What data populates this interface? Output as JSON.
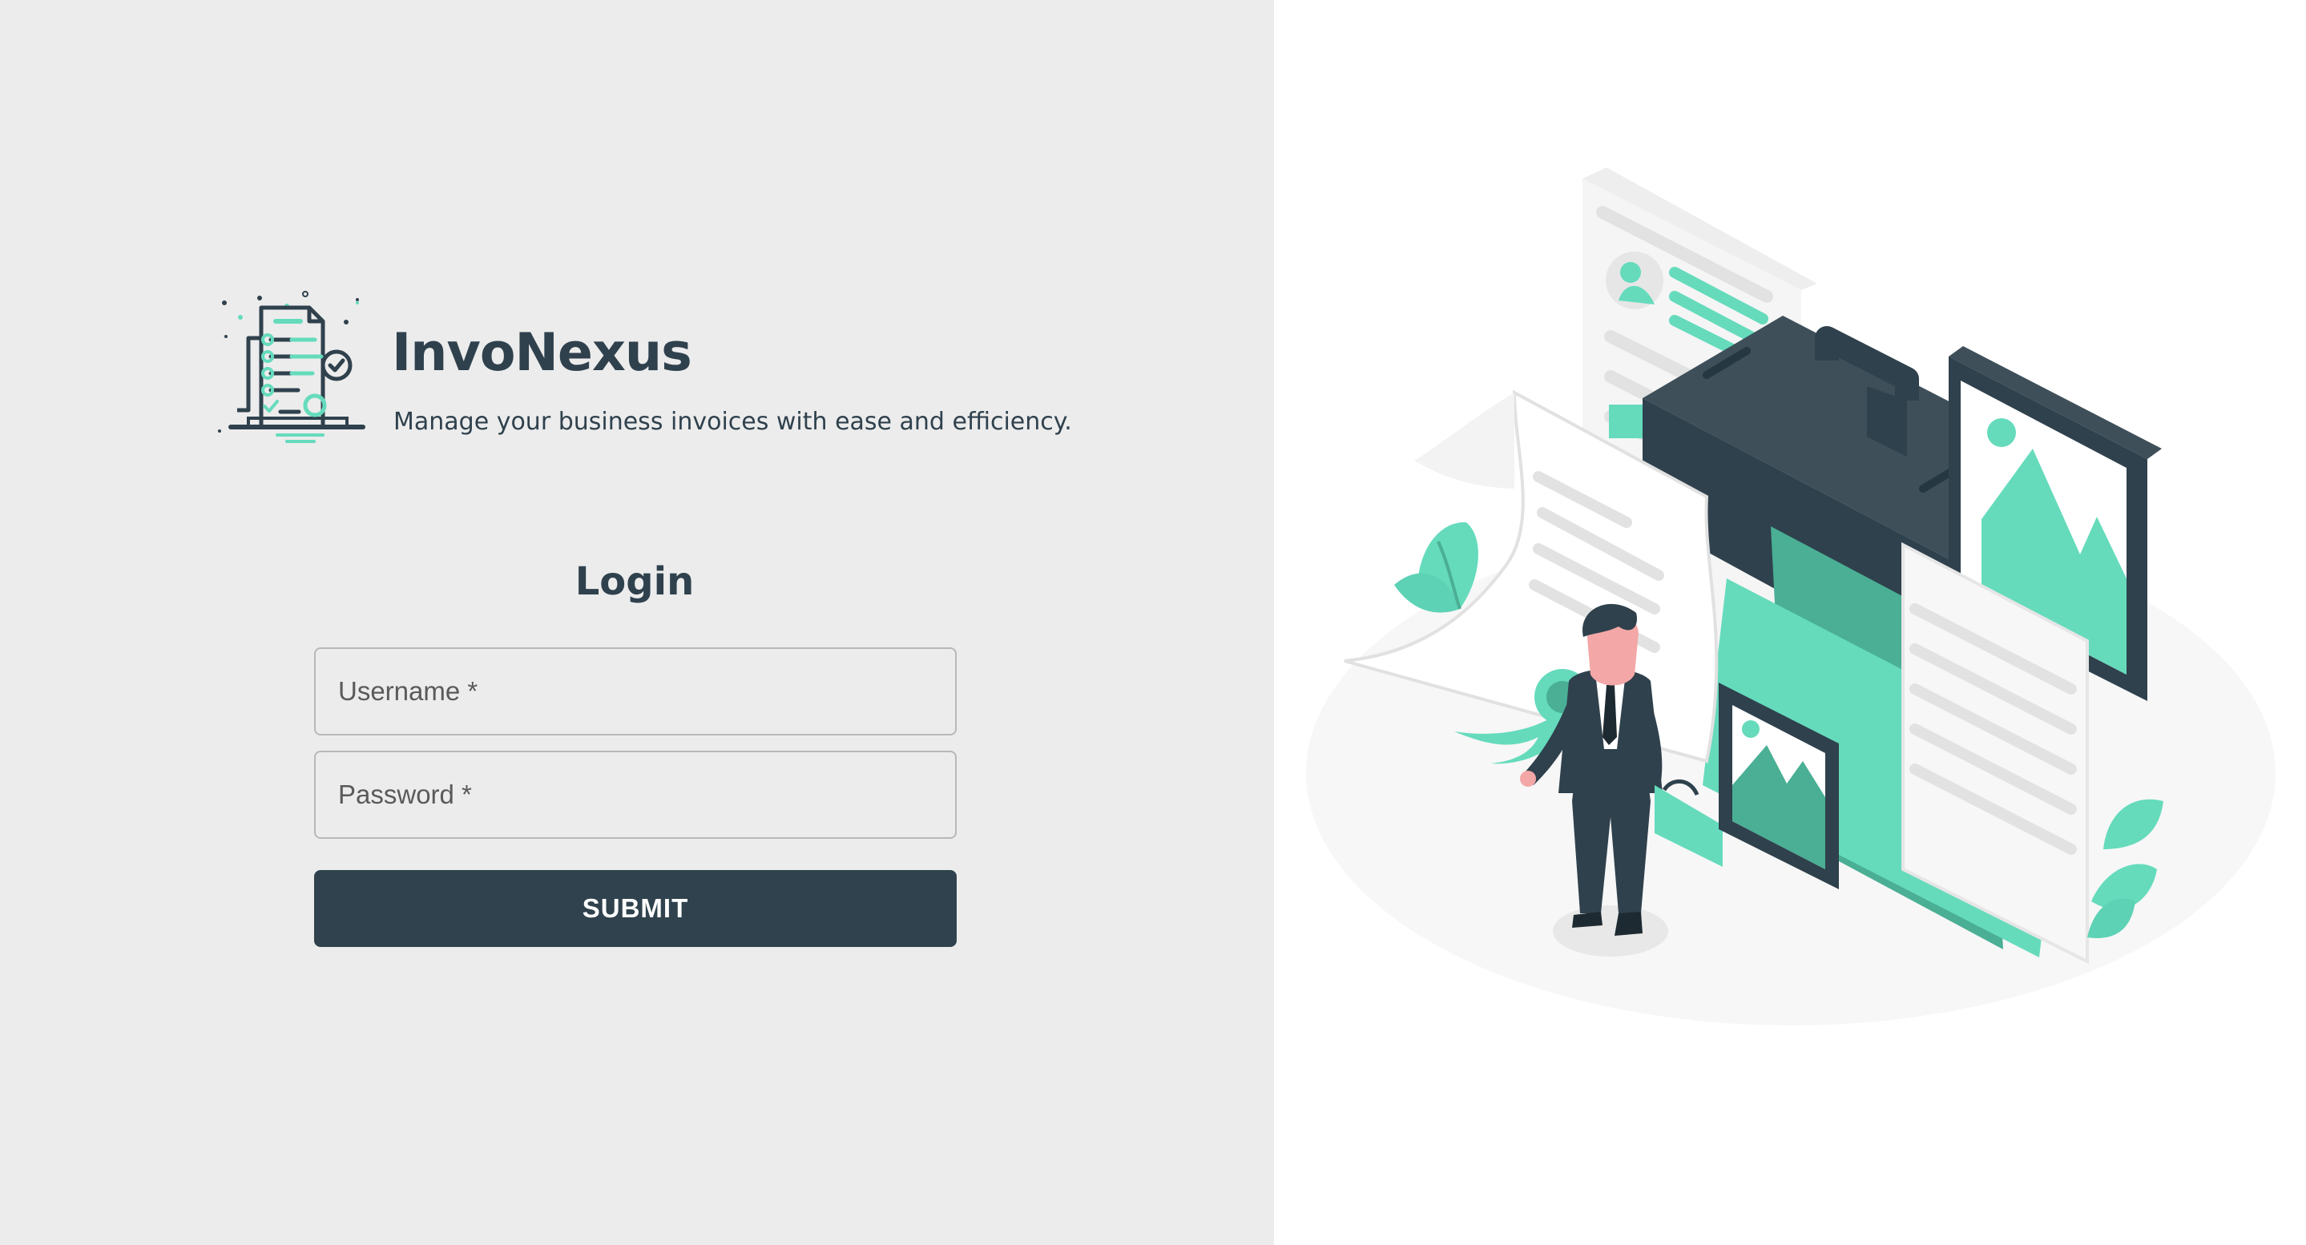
{
  "app": {
    "name": "InvoNexus",
    "tagline": "Manage your business invoices with ease and efficiency."
  },
  "login": {
    "title": "Login",
    "username_placeholder": "Username *",
    "password_placeholder": "Password *",
    "submit_label": "SUBMIT"
  },
  "icons": {
    "logo": "invoice-document-laptop-icon",
    "illustration": "business-document-illustration"
  },
  "colors": {
    "left_background": "#ececec",
    "right_background": "#ffffff",
    "primary": "#2f424d",
    "accent": "#65dbbc",
    "border": "#b8b8b8"
  }
}
